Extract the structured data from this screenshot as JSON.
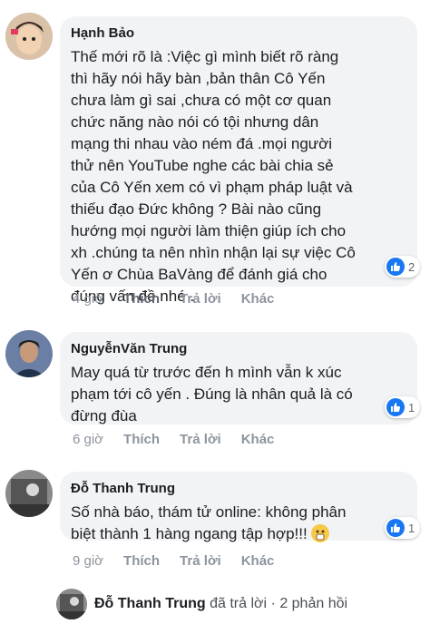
{
  "comments": [
    {
      "author": "Hạnh Bảo",
      "lines": [
        "Thế mới rõ là :Việc gì mình biết rõ ràng",
        "thì hãy nói hãy bàn ,bản thân Cô Yến",
        "chưa làm gì sai ,chưa có một cơ quan",
        "chức năng nào nói có tội nhưng dân",
        "mạng thi nhau vào ném đá .mọi người",
        "thử nên YouTube nghe các bài chia sẻ",
        "của Cô Yến xem có vì phạm pháp luật và",
        "thiếu đạo Đức không ? Bài nào cũng",
        "hướng mọi người làm thiện giúp ích cho",
        "xh .chúng ta nên nhìn nhận lại sự việc Cô",
        "Yến ơ Chùa BaVàng để đánh giá cho",
        "đúng vấn đề nhé ."
      ],
      "reactions": "2",
      "time": "4 giờ",
      "like_label": "Thích",
      "reply_label": "Trả lời",
      "more_label": "Khác"
    },
    {
      "author": "NguyễnVăn Trung",
      "lines": [
        "May quá từ trước đến h mình vẫn k xúc",
        "phạm tới cô yến . Đúng là nhân quả là có",
        "đừng đùa"
      ],
      "reactions": "1",
      "time": "6 giờ",
      "like_label": "Thích",
      "reply_label": "Trả lời",
      "more_label": "Khác"
    },
    {
      "author": "Đỗ Thanh Trung",
      "lines": [
        "Số nhà báo, thám tử online: không phân",
        "biệt thành 1 hàng ngang tập hợp!!!"
      ],
      "reactions": "1",
      "time": "9 giờ",
      "like_label": "Thích",
      "reply_label": "Trả lời",
      "more_label": "Khác"
    }
  ],
  "reply_summary": {
    "author": "Đỗ Thanh Trung",
    "action": "đã trả lời",
    "separator": "·",
    "count": "2 phản hồi"
  },
  "colors": {
    "like_blue": "#1877f2",
    "bubble": "#f2f3f5",
    "meta": "#8d949e"
  }
}
